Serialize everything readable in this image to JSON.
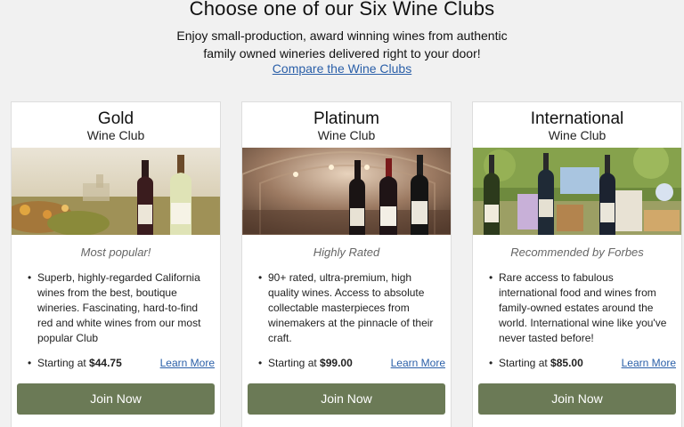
{
  "header": {
    "title": "Choose one of our Six Wine Clubs",
    "intro_line1": "Enjoy small-production, award winning wines from authentic",
    "intro_line2": "family owned wineries delivered right to your door!",
    "compare_link": "Compare the Wine Clubs"
  },
  "clubs": [
    {
      "name": "Gold",
      "subtitle": "Wine Club",
      "tagline": "Most popular!",
      "description": "Superb, highly-regarded California wines from the best, boutique wineries. Fascinating, hard-to-find red and white wines from our most popular Club",
      "price_label": "Starting at",
      "price": "$44.75",
      "learn_more": "Learn More",
      "join": "Join Now"
    },
    {
      "name": "Platinum",
      "subtitle": "Wine Club",
      "tagline": "Highly Rated",
      "description": "90+ rated, ultra-premium, high quality wines. Access to absolute collectable masterpieces from winemakers at the pinnacle of their craft.",
      "price_label": "Starting at",
      "price": "$99.00",
      "learn_more": "Learn More",
      "join": "Join Now"
    },
    {
      "name": "International",
      "subtitle": "Wine Club",
      "tagline": "Recommended by Forbes",
      "description": "Rare access to fabulous international food and wines from family-owned estates around the world. International wine like you've never tasted before!",
      "price_label": "Starting at",
      "price": "$85.00",
      "learn_more": "Learn More",
      "join": "Join Now"
    }
  ],
  "colors": {
    "button": "#6b7a56",
    "link": "#2a5fa8",
    "background": "#f1f1f1"
  }
}
